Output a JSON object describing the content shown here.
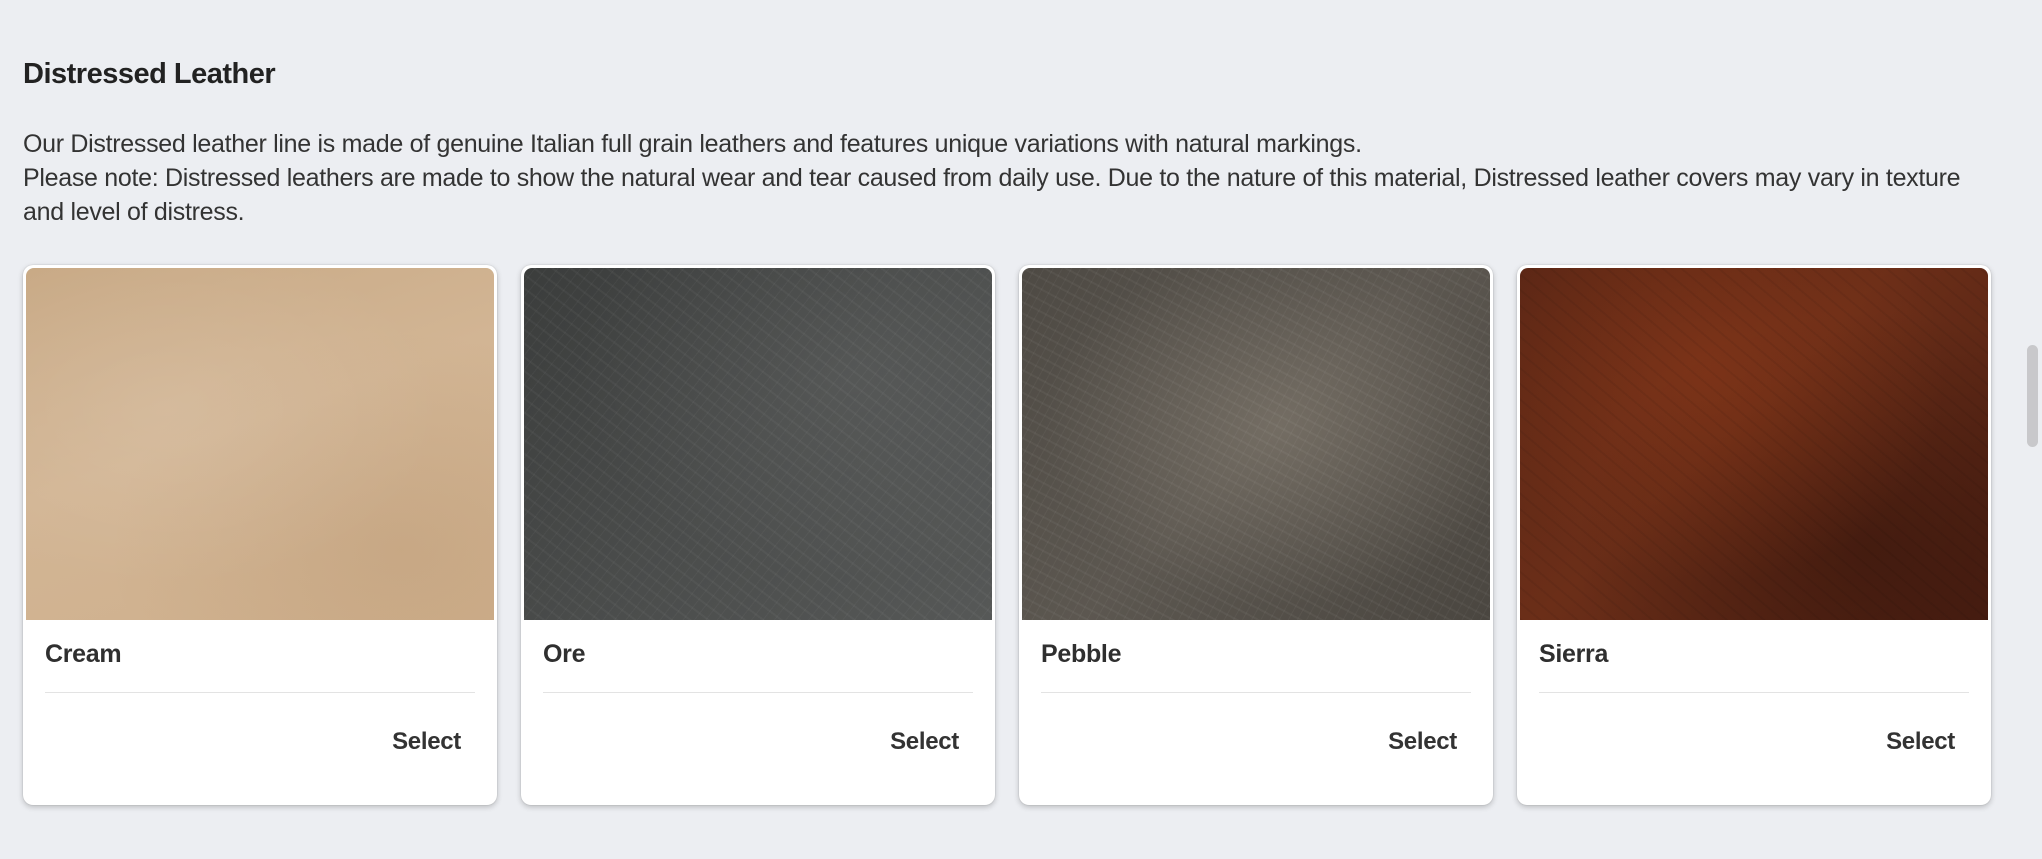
{
  "section": {
    "title": "Distressed Leather",
    "description_line1": "Our Distressed leather line is made of genuine Italian full grain leathers and features unique variations with natural markings.",
    "description_line2": "Please note: Distressed leathers are made to show the natural wear and tear caused from daily use. Due to the nature of this material, Distressed leather covers may vary in texture and level of distress."
  },
  "cards": [
    {
      "name": "Cream",
      "select_label": "Select",
      "swatch_color": "#cfb08d"
    },
    {
      "name": "Ore",
      "select_label": "Select",
      "swatch_color": "#4a4c4b"
    },
    {
      "name": "Pebble",
      "select_label": "Select",
      "swatch_color": "#5c5750"
    },
    {
      "name": "Sierra",
      "select_label": "Select",
      "swatch_color": "#6b2e18"
    }
  ]
}
